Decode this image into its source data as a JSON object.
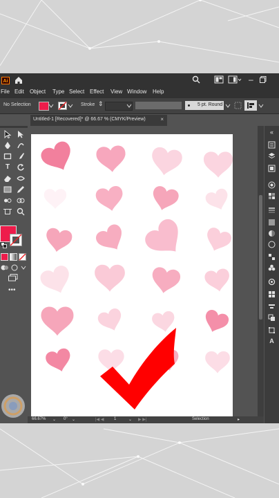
{
  "menu": [
    "File",
    "Edit",
    "Object",
    "Type",
    "Select",
    "Effect",
    "View",
    "Window",
    "Help"
  ],
  "control_bar": {
    "selection_status": "No Selection",
    "stroke_label": "Stroke",
    "brush_label": "5 pt. Round"
  },
  "document_tab": {
    "title": "Untitled-1 [Recovered]* @ 66.67 % (CMYK/Preview)",
    "close": "×"
  },
  "status_bar": {
    "zoom": "66.67%",
    "rotation": "0°",
    "artboard_number": "1",
    "tool_name": "Selection"
  },
  "colors": {
    "fill": "#ee1c4b",
    "heart_dark": "#f06a8c",
    "heart_mid": "#f7a7bd",
    "heart_light": "#fbd5e0",
    "checkmark": "#ff0000"
  }
}
